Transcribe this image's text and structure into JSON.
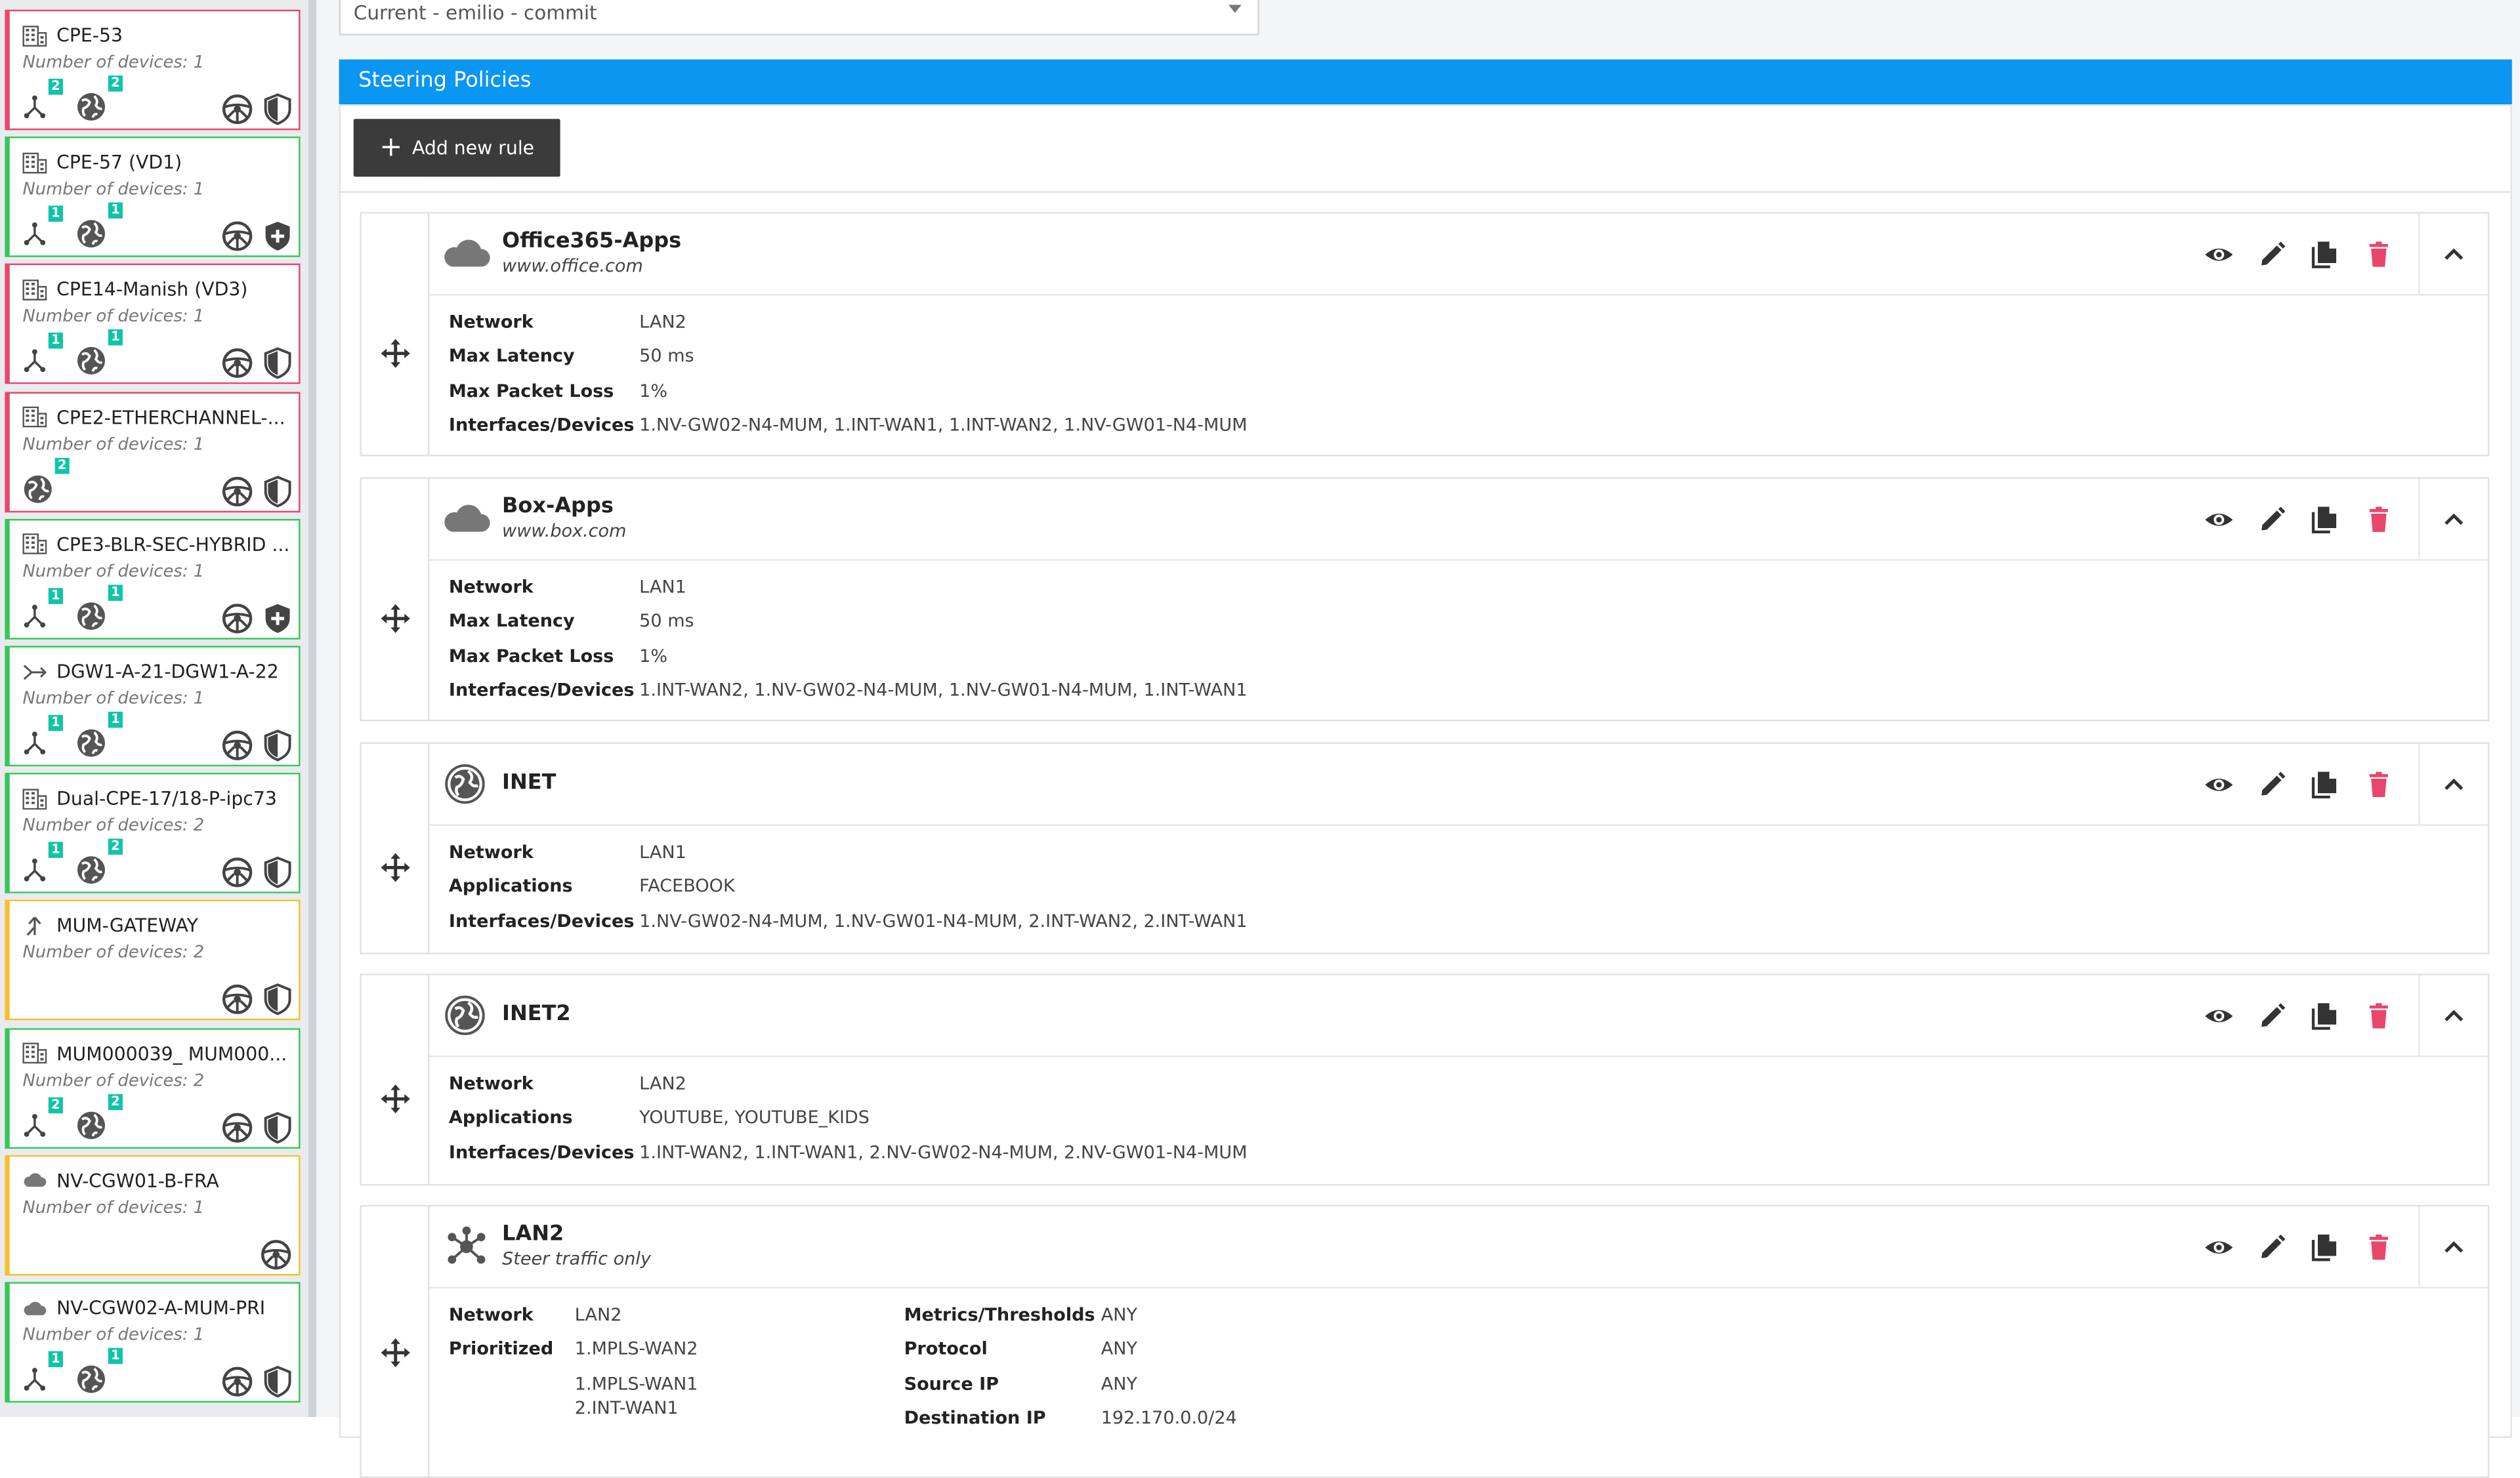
{
  "sidebar": {
    "devices_prefix": "Number of devices: ",
    "cards": [
      {
        "name": "CPE-53",
        "devices": "1",
        "status": "red",
        "type": "building",
        "topology": "2",
        "internet": "2",
        "right_icons": [
          "steering-icon",
          "shield-icon"
        ]
      },
      {
        "name": "CPE-57 (VD1)",
        "devices": "1",
        "status": "green",
        "type": "building",
        "topology": "1",
        "internet": "1",
        "right_icons": [
          "steering-icon",
          "shield-plus-icon"
        ]
      },
      {
        "name": "CPE14-Manish (VD3)",
        "devices": "1",
        "status": "red",
        "type": "building",
        "topology": "1",
        "internet": "1",
        "right_icons": [
          "steering-icon",
          "shield-icon"
        ]
      },
      {
        "name": "CPE2-ETHERCHANNEL-...",
        "devices": "1",
        "status": "red",
        "type": "building",
        "topology": "",
        "internet": "2",
        "right_icons": [
          "steering-icon",
          "shield-icon"
        ]
      },
      {
        "name": "CPE3-BLR-SEC-HYBRID ...",
        "devices": "1",
        "status": "green",
        "type": "building",
        "topology": "1",
        "internet": "1",
        "right_icons": [
          "steering-icon",
          "shield-plus-icon"
        ]
      },
      {
        "name": "DGW1-A-21-DGW1-A-22",
        "devices": "1",
        "status": "green",
        "type": "gateway",
        "topology": "1",
        "internet": "1",
        "right_icons": [
          "steering-icon",
          "shield-icon"
        ]
      },
      {
        "name": "Dual-CPE-17/18-P-ipc73",
        "devices": "2",
        "status": "green",
        "type": "building",
        "topology": "1",
        "internet": "2",
        "right_icons": [
          "steering-icon",
          "shield-icon"
        ]
      },
      {
        "name": "MUM-GATEWAY",
        "devices": "2",
        "status": "yellow",
        "type": "merge",
        "topology": "",
        "internet": "",
        "right_icons": [
          "steering-icon",
          "shield-icon"
        ]
      },
      {
        "name": "MUM000039_ MUM000...",
        "devices": "2",
        "status": "green",
        "type": "building",
        "topology": "2",
        "internet": "2",
        "right_icons": [
          "steering-icon",
          "shield-icon"
        ]
      },
      {
        "name": "NV-CGW01-B-FRA",
        "devices": "1",
        "status": "yellow",
        "type": "cloud",
        "topology": "",
        "internet": "",
        "right_icons": [
          "steering-icon"
        ]
      },
      {
        "name": "NV-CGW02-A-MUM-PRI",
        "devices": "1",
        "status": "green",
        "type": "cloud",
        "topology": "1",
        "internet": "1",
        "right_icons": [
          "steering-icon",
          "shield-icon"
        ]
      }
    ]
  },
  "main": {
    "select_value": "Current - emilio - commit",
    "section_title": "Steering Policies",
    "add_rule_label": "Add new rule",
    "rules": [
      {
        "title": "Office365-Apps",
        "subtitle": "www.office.com",
        "icon": "cloud-icon",
        "fields": [
          {
            "k": "Network",
            "v": "LAN2"
          },
          {
            "k": "Max Latency",
            "v": "50 ms"
          },
          {
            "k": "Max Packet Loss",
            "v": "1%"
          },
          {
            "k": "Interfaces/Devices",
            "v": "1.NV-GW02-N4-MUM, 1.INT-WAN1, 1.INT-WAN2, 1.NV-GW01-N4-MUM"
          }
        ]
      },
      {
        "title": "Box-Apps",
        "subtitle": "www.box.com",
        "icon": "cloud-icon",
        "fields": [
          {
            "k": "Network",
            "v": "LAN1"
          },
          {
            "k": "Max Latency",
            "v": "50 ms"
          },
          {
            "k": "Max Packet Loss",
            "v": "1%"
          },
          {
            "k": "Interfaces/Devices",
            "v": "1.INT-WAN2, 1.NV-GW02-N4-MUM, 1.NV-GW01-N4-MUM, 1.INT-WAN1"
          }
        ]
      },
      {
        "title": "INET",
        "subtitle": "",
        "icon": "globe-icon",
        "fields": [
          {
            "k": "Network",
            "v": "LAN1"
          },
          {
            "k": "Applications",
            "v": "FACEBOOK"
          },
          {
            "k": "Interfaces/Devices",
            "v": "1.NV-GW02-N4-MUM, 1.NV-GW01-N4-MUM, 2.INT-WAN2, 2.INT-WAN1"
          }
        ]
      },
      {
        "title": "INET2",
        "subtitle": "",
        "icon": "globe-icon",
        "fields": [
          {
            "k": "Network",
            "v": "LAN2"
          },
          {
            "k": "Applications",
            "v": "YOUTUBE, YOUTUBE_KIDS"
          },
          {
            "k": "Interfaces/Devices",
            "v": "1.INT-WAN2, 1.INT-WAN1, 2.NV-GW02-N4-MUM, 2.NV-GW01-N4-MUM"
          }
        ]
      },
      {
        "title": "LAN2",
        "subtitle": "Steer traffic only",
        "icon": "network-hub-icon",
        "fields": [
          {
            "k": "Network",
            "v": "LAN2"
          },
          {
            "k": "Prioritized",
            "v": "1.MPLS-WAN2"
          },
          {
            "k": "",
            "v": "1.MPLS-WAN1"
          },
          {
            "k": "",
            "v": "2.INT-WAN1"
          }
        ],
        "fields_right": [
          {
            "k": "Metrics/Thresholds",
            "v": "ANY"
          },
          {
            "k": "Protocol",
            "v": "ANY"
          },
          {
            "k": "Source IP",
            "v": "ANY"
          },
          {
            "k": "Destination IP",
            "v": "192.170.0.0/24"
          }
        ]
      }
    ]
  }
}
